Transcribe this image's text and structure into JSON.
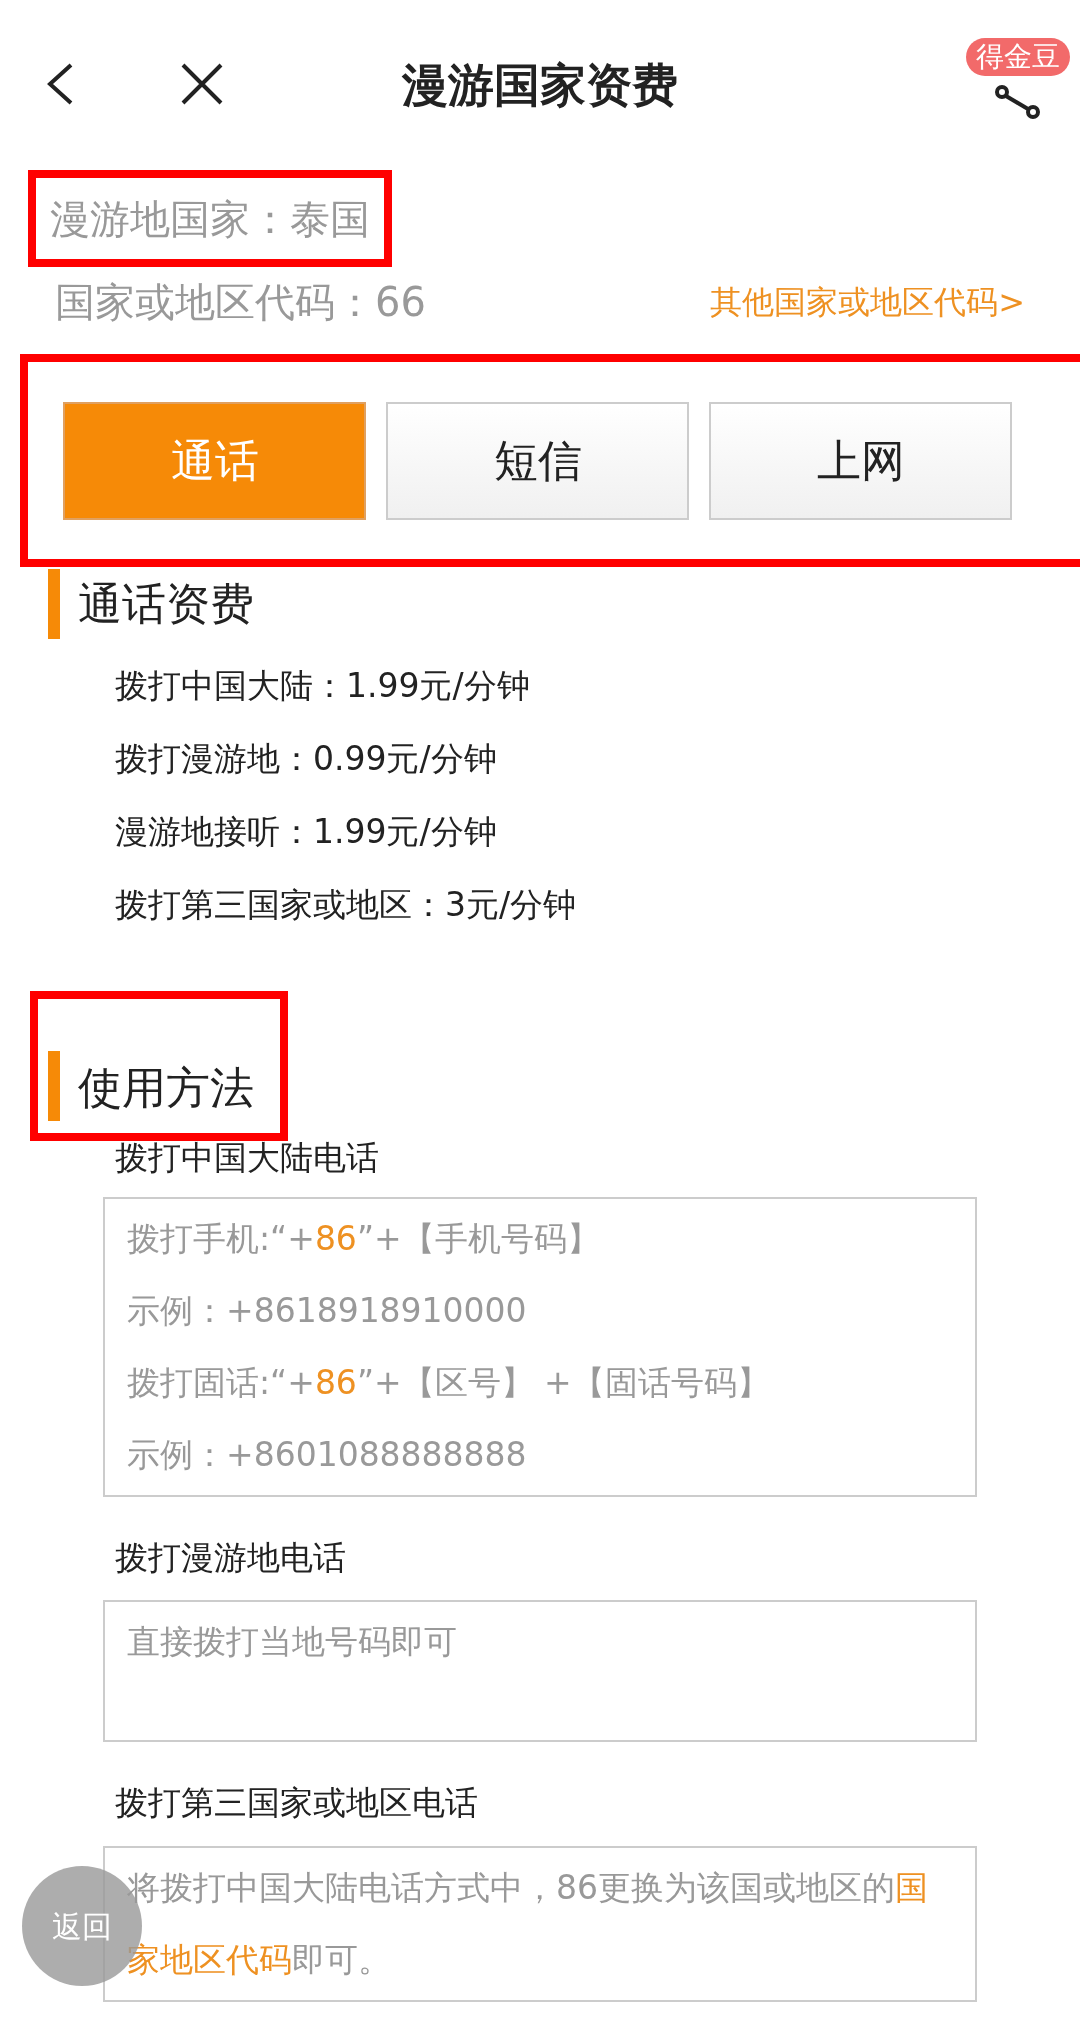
{
  "header": {
    "title": "漫游国家资费",
    "badge": "得金豆"
  },
  "country": {
    "label": "漫游地国家：泰国",
    "highlighted": true
  },
  "code": {
    "label": "国家或地区代码：66",
    "link": "其他国家或地区代码>"
  },
  "tabs_highlighted": true,
  "tabs": [
    {
      "label": "通话",
      "selected": true
    },
    {
      "label": "短信",
      "selected": false
    },
    {
      "label": "上网",
      "selected": false
    }
  ],
  "tariff": {
    "heading": "通话资费",
    "lines": [
      "拨打中国大陆：1.99元/分钟",
      "拨打漫游地：0.99元/分钟",
      "漫游地接听：1.99元/分钟",
      "拨打第三国家或地区：3元/分钟"
    ]
  },
  "usage": {
    "heading": "使用方法",
    "highlighted": true,
    "sections": [
      {
        "title": "拨打中国大陆电话",
        "lines": [
          [
            {
              "text": "拨打手机:“+",
              "accent": false
            },
            {
              "text": "86",
              "accent": true
            },
            {
              "text": "”+【手机号码】",
              "accent": false
            }
          ],
          [
            {
              "text": "示例：+8618918910000",
              "accent": false
            }
          ],
          [
            {
              "text": "拨打固话:“+",
              "accent": false
            },
            {
              "text": "86",
              "accent": true
            },
            {
              "text": "”+【区号】 +【固话号码】",
              "accent": false
            }
          ],
          [
            {
              "text": "示例：+8601088888888",
              "accent": false
            }
          ]
        ]
      },
      {
        "title": "拨打漫游地电话",
        "lines": [
          [
            {
              "text": "直接拨打当地号码即可",
              "accent": false
            }
          ]
        ]
      },
      {
        "title": "拨打第三国家或地区电话",
        "lines": [
          [
            {
              "text": "将拨打中国大陆电话方式中，86更换为该国或地区的",
              "accent": false
            },
            {
              "text": "国家地区代码",
              "accent": true
            },
            {
              "text": "即可。",
              "accent": false
            }
          ]
        ]
      }
    ]
  },
  "floating_button": "返回"
}
